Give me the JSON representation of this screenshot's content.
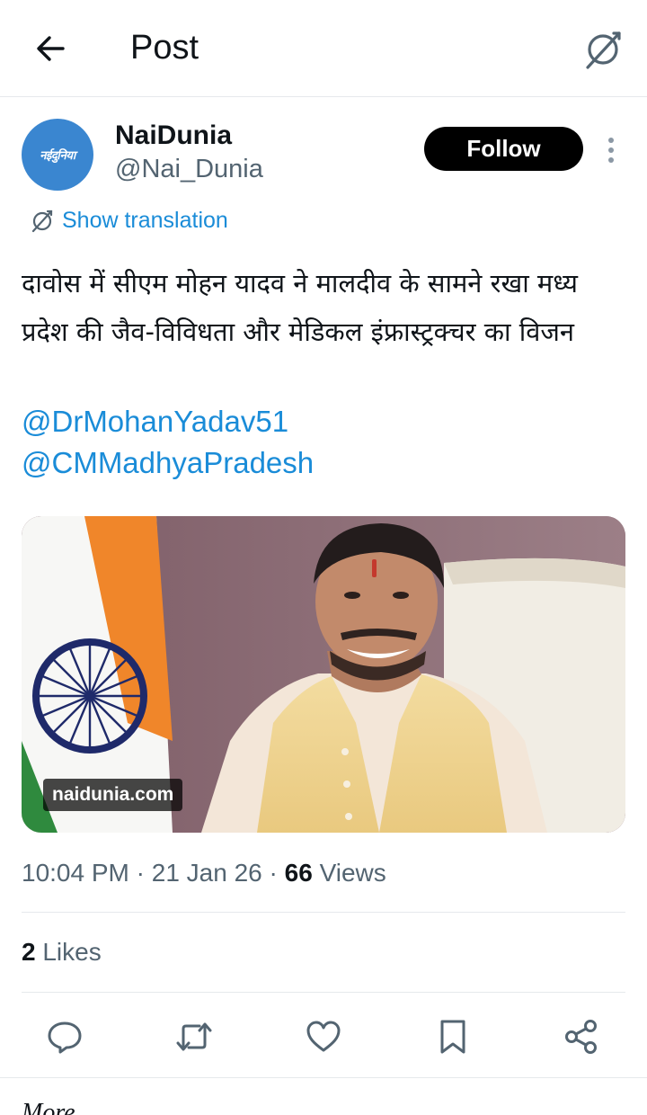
{
  "header": {
    "title": "Post",
    "back_icon": "arrow-left-icon",
    "translate_icon": "translate-icon"
  },
  "author": {
    "avatar_text": "नईदुनिया",
    "display_name": "NaiDunia",
    "handle": "@Nai_Dunia",
    "follow_label": "Follow",
    "more_icon": "more-vertical-icon"
  },
  "translation": {
    "label": "Show translation"
  },
  "post": {
    "text": "दावोस में सीएम मोहन यादव ने मालदीव के सामने रखा मध्य प्रदेश की जैव-विविधता और मेडिकल इंफ्रास्ट्रक्चर का विजन",
    "mentions": [
      "@DrMohanYadav51",
      "@CMMadhyaPradesh"
    ],
    "media_watermark": "naidunia.com"
  },
  "meta": {
    "time": "10:04 PM",
    "sep1": " · ",
    "date": "21 Jan 26",
    "sep2": " · ",
    "views_count": "66",
    "views_label": " Views"
  },
  "likes": {
    "count": "2",
    "label": " Likes"
  },
  "actions": [
    {
      "name": "reply-icon"
    },
    {
      "name": "repost-icon"
    },
    {
      "name": "like-icon"
    },
    {
      "name": "bookmark-icon"
    },
    {
      "name": "share-icon"
    }
  ],
  "colors": {
    "link": "#1a8cd8",
    "text": "#0f1419",
    "secondary": "#536471",
    "follow_bg": "#000000",
    "avatar_bg": "#3a86d0"
  },
  "footer": {
    "more_text": "More"
  }
}
